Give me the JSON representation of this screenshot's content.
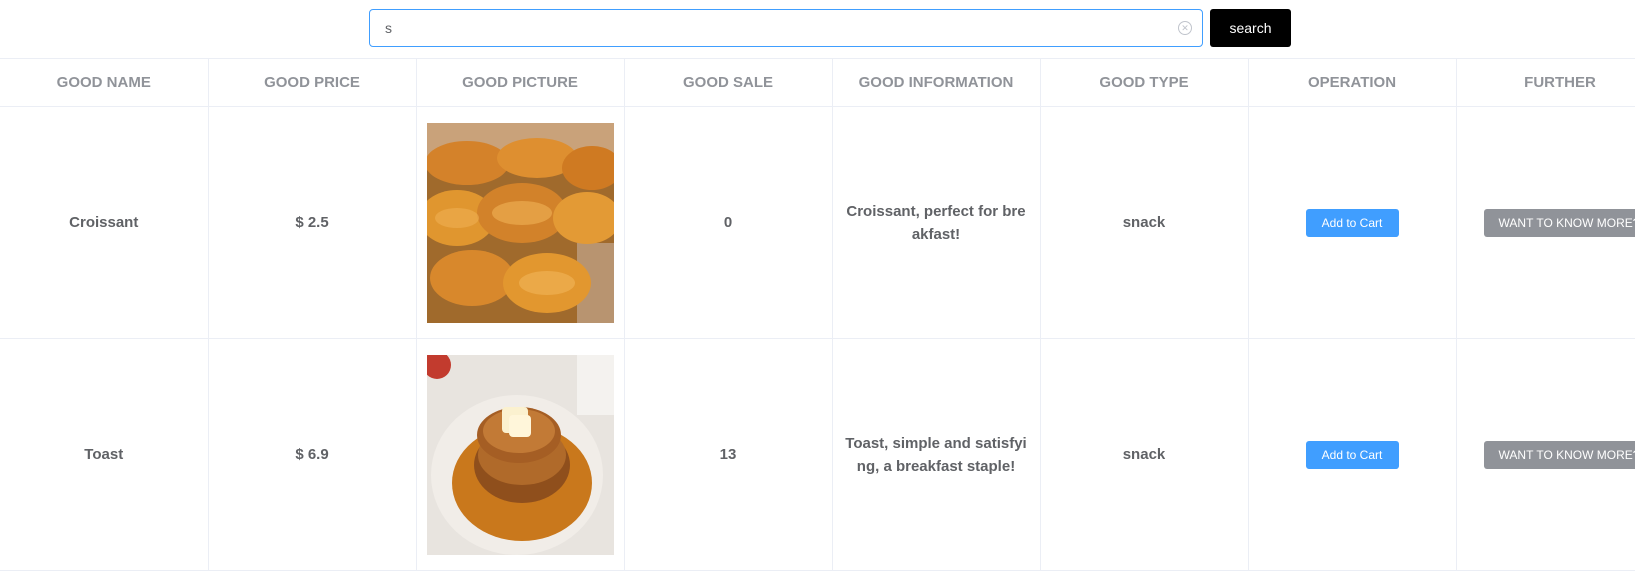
{
  "search": {
    "value": "s",
    "placeholder": "",
    "button_label": "search"
  },
  "table": {
    "headers": [
      "GOOD NAME",
      "GOOD PRICE",
      "GOOD PICTURE",
      "GOOD SALE",
      "GOOD INFORMATION",
      "GOOD TYPE",
      "OPERATION",
      "FURTHER"
    ],
    "rows": [
      {
        "name": "Croissant",
        "price": "$ 2.5",
        "picture": "croissant-photo",
        "sale": "0",
        "info": "Croissant, perfect for breakfast!",
        "type": "snack",
        "operation_label": "Add to Cart",
        "further_label": "WANT TO KNOW MORE?"
      },
      {
        "name": "Toast",
        "price": "$ 6.9",
        "picture": "french-toast-photo",
        "sale": "13",
        "info": "Toast, simple and satisfying, a breakfast staple!",
        "type": "snack",
        "operation_label": "Add to Cart",
        "further_label": "WANT TO KNOW MORE?"
      }
    ]
  },
  "colors": {
    "accent": "#409eff",
    "search_button": "#000000",
    "more_button": "#909399"
  }
}
